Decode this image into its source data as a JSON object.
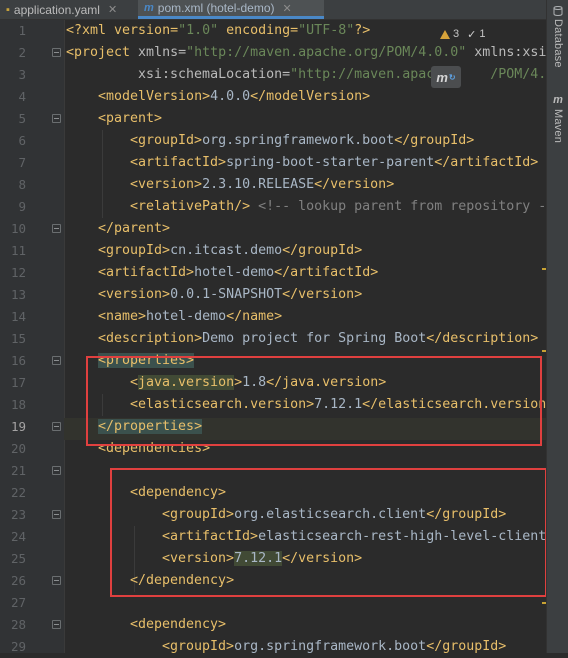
{
  "tabs": [
    {
      "label": "application.yaml",
      "icon": "yaml-file-icon",
      "active": false
    },
    {
      "label": "pom.xml (hotel-demo)",
      "icon": "maven-file-icon",
      "active": true
    }
  ],
  "inspection": {
    "warnings": "3",
    "ok": "1",
    "warning_color": "#d7a33a"
  },
  "floating_button": {
    "label": "m",
    "icon": "maven-reload-icon"
  },
  "right_panel": [
    {
      "label": "Database",
      "icon": "database-icon"
    },
    {
      "label": "Maven",
      "icon": "maven-icon"
    }
  ],
  "current_line": "19",
  "line_numbers": [
    "1",
    "2",
    "3",
    "4",
    "5",
    "6",
    "7",
    "8",
    "9",
    "10",
    "11",
    "12",
    "13",
    "14",
    "15",
    "16",
    "17",
    "18",
    "19",
    "20",
    "21",
    "22",
    "23",
    "24",
    "25",
    "26",
    "27",
    "28",
    "29"
  ],
  "code": {
    "l1": {
      "p1": "<?xml version=",
      "p2": "\"1.0\"",
      "p3": " encoding=",
      "p4": "\"UTF-8\"",
      "p5": "?>"
    },
    "l2": {
      "tag": "<project",
      "a1": " xmlns=",
      "v1": "\"http://maven.apache.org/POM/4.0.0\"",
      "a2": " xmlns:xsi"
    },
    "l3": {
      "a1": "xsi",
      "a2": ":schemaLocation=",
      "v1": "\"http://maven.apache",
      "v2": "/POM/4.0"
    },
    "l4": {
      "open": "<modelVersion>",
      "text": "4.0.0",
      "close": "</modelVersion>"
    },
    "l5": {
      "tag": "<parent>"
    },
    "l6": {
      "open": "<groupId>",
      "text": "org.springframework.boot",
      "close": "</groupId>"
    },
    "l7": {
      "open": "<artifactId>",
      "text": "spring-boot-starter-parent",
      "close": "</artifactId>"
    },
    "l8": {
      "open": "<version>",
      "text": "2.3.10.RELEASE",
      "close": "</version>"
    },
    "l9": {
      "tag": "<relativePath/>",
      "comment": " <!-- lookup parent from repository -"
    },
    "l10": {
      "tag": "</parent>"
    },
    "l11": {
      "open": "<groupId>",
      "text": "cn.itcast.demo",
      "close": "</groupId>"
    },
    "l12": {
      "open": "<artifactId>",
      "text": "hotel-demo",
      "close": "</artifactId>"
    },
    "l13": {
      "open": "<version>",
      "text": "0.0.1-SNAPSHOT",
      "close": "</version>"
    },
    "l14": {
      "open": "<name>",
      "text": "hotel-demo",
      "close": "</name>"
    },
    "l15": {
      "open": "<description>",
      "text": "Demo project for Spring Boot",
      "close": "</description>"
    },
    "l16": {
      "tag": "<properties>"
    },
    "l17": {
      "lt": "<",
      "name": "java.version",
      "gt": ">",
      "text": "1.8",
      "close": "</java.version>"
    },
    "l18": {
      "open": "<elasticsearch.version>",
      "text": "7.12.1",
      "close": "</elasticsearch.version"
    },
    "l19": {
      "tag": "</properties>"
    },
    "l20": {
      "tag": "<dependencies>"
    },
    "l22": {
      "tag": "<dependency>"
    },
    "l23": {
      "open": "<groupId>",
      "text": "org.elasticsearch.client",
      "close": "</groupId>"
    },
    "l24": {
      "open": "<artifactId>",
      "text": "elasticsearch-rest-high-level-client"
    },
    "l25": {
      "open": "<version>",
      "text": "7.12.1",
      "close": "</version>"
    },
    "l26": {
      "tag": "</dependency>"
    },
    "l28": {
      "tag": "<dependency>"
    },
    "l29": {
      "open": "<groupId>",
      "text": "org.springframework.boot",
      "close": "</groupId>"
    }
  },
  "colors": {
    "annotation_box": "#e0403f",
    "tag": "#e8bf6a",
    "string": "#6a8759",
    "comment": "#808080"
  }
}
